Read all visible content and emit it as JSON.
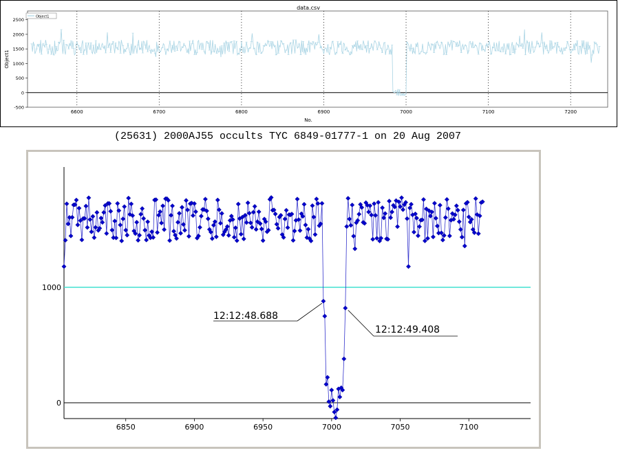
{
  "caption": "(25631) 2000AJ55 occults TYC 6849-01777-1 on 20 Aug 2007",
  "chart_data": [
    {
      "type": "line",
      "title": "data.csv",
      "xlabel": "No.",
      "ylabel": "Object1",
      "legend": {
        "entries": [
          "Object1"
        ],
        "placement": "top-left"
      },
      "xlim": [
        6540,
        7245
      ],
      "ylim": [
        -500,
        2800
      ],
      "x_ticks": [
        6600,
        6700,
        6800,
        6900,
        7000,
        7100,
        7200
      ],
      "y_ticks": [
        -500,
        0,
        500,
        1000,
        1500,
        2000,
        2500
      ],
      "grid": "vertical dotted",
      "series": [
        {
          "name": "Object1",
          "color": "#a9d4e4",
          "x_start": 6545,
          "x_end": 7235,
          "baseline": 1550,
          "scatter": 260,
          "dip": {
            "x_from": 6984,
            "x_to": 7000,
            "value": 0
          }
        }
      ]
    },
    {
      "type": "line",
      "title": "",
      "xlim": [
        6805,
        7145
      ],
      "ylim": [
        -130,
        1030
      ],
      "x_ticks": [
        6850,
        6900,
        6950,
        7000,
        7050,
        7100
      ],
      "y_ticks": [
        0,
        1000
      ],
      "reference_lines": [
        {
          "y": 1000,
          "color": "#40e0d0"
        },
        {
          "y": 0,
          "color": "#000000"
        }
      ],
      "annotations": [
        {
          "text": "12:12:48.688",
          "x": 6994,
          "y": 880
        },
        {
          "text": "12:12:49.408",
          "x": 7011,
          "y": 820
        }
      ],
      "series": [
        {
          "name": "",
          "color": "#0000cc",
          "x_start": 6805,
          "x_end": 7110,
          "baseline": 1590,
          "scatter": 190,
          "min_value": -130
        }
      ]
    }
  ]
}
